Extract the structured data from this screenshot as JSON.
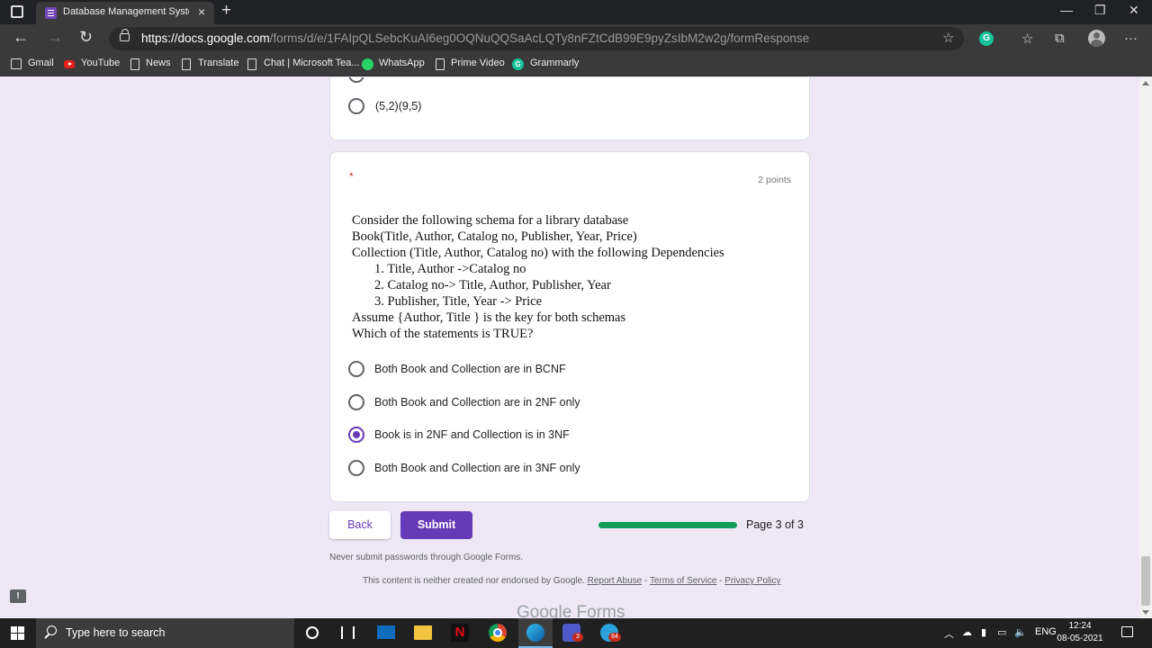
{
  "browser": {
    "tab_title": "Database Management System",
    "tab_close": "×",
    "new_tab": "+",
    "url_host": "https://docs.google.com",
    "url_path": "/forms/d/e/1FAIpQLSebcKuAI6eg0OQNuQQSaAcLQTy8nFZtCdB99E9pyZsIbM2w2g/formResponse",
    "window_controls": [
      "—",
      "❐",
      "✕"
    ],
    "nav": {
      "back": "←",
      "forward": "→",
      "reload": "↻"
    },
    "extension_letter": "G",
    "menu": "···"
  },
  "bookmarks": [
    {
      "label": "Gmail",
      "icon": "gmail-icon"
    },
    {
      "label": "YouTube",
      "icon": "youtube-icon"
    },
    {
      "label": "News",
      "icon": "page-icon"
    },
    {
      "label": "Translate",
      "icon": "page-icon"
    },
    {
      "label": "Chat | Microsoft Tea...",
      "icon": "page-icon"
    },
    {
      "label": "WhatsApp",
      "icon": "whatsapp-icon"
    },
    {
      "label": "Prime Video",
      "icon": "page-icon"
    },
    {
      "label": "Grammarly",
      "icon": "grammarly-icon"
    }
  ],
  "form": {
    "prev_question": {
      "visible_option": "(5,2)(9,5)"
    },
    "question": {
      "required_mark": "*",
      "points": "2 points",
      "text_lines": [
        "Consider the following  schema for a library database",
        "Book(Title, Author, Catalog no, Publisher, Year, Price)",
        "Collection (Title, Author, Catalog no) with the following  Dependencies",
        "1.   Title, Author ->Catalog no",
        "2.   Catalog no-> Title, Author, Publisher, Year",
        "3.   Publisher, Title, Year -> Price",
        "Assume {Author, Title } is the key for both schemas",
        "Which of the statements is TRUE?"
      ],
      "options": [
        {
          "label": "Both Book and Collection are in BCNF",
          "selected": false
        },
        {
          "label": "Both Book and Collection are in 2NF only",
          "selected": false
        },
        {
          "label": "Book is in 2NF and Collection is in 3NF",
          "selected": true
        },
        {
          "label": "Both Book and Collection are in 3NF only",
          "selected": false
        }
      ]
    },
    "back_label": "Back",
    "submit_label": "Submit",
    "progress": 1.0,
    "page_indicator": "Page 3 of 3",
    "never_submit": "Never submit passwords through Google Forms.",
    "footer_text": "This content is neither created nor endorsed by Google.",
    "footer_links": [
      "Report Abuse",
      "Terms of Service",
      "Privacy Policy"
    ],
    "logo": "Google Forms",
    "feedback": "!"
  },
  "taskbar": {
    "search_placeholder": "Type here to search",
    "teams_badge": "3",
    "telegram_badge": "64",
    "language": "ENG",
    "time": "12:24",
    "date": "08-05-2021"
  },
  "colors": {
    "accent": "#673ab7",
    "progress": "#0f9d58",
    "page_bg": "#ede7f6"
  }
}
